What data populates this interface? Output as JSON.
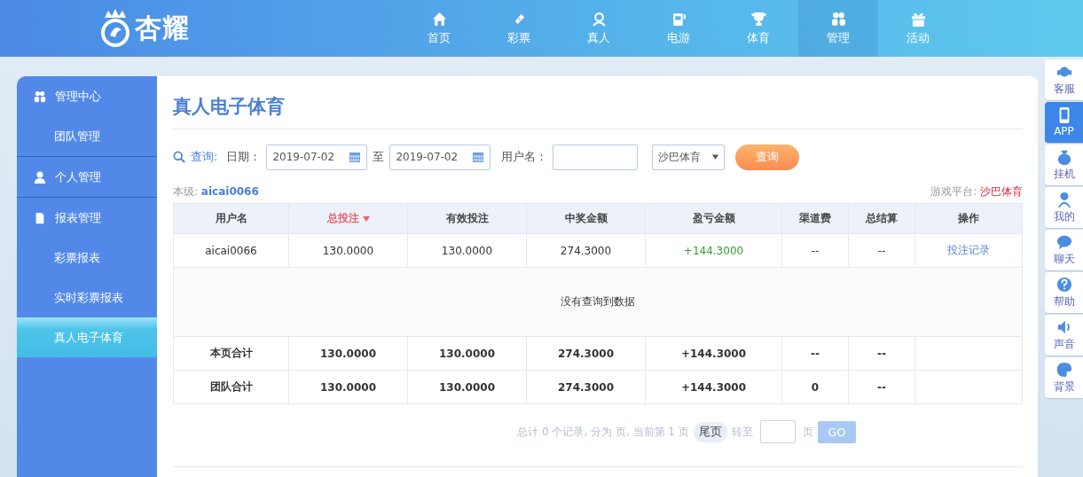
{
  "header": {
    "logo": "杏耀",
    "nav": [
      {
        "label": "首页",
        "selected": false
      },
      {
        "label": "彩票",
        "selected": false
      },
      {
        "label": "真人",
        "selected": false
      },
      {
        "label": "电游",
        "selected": false
      },
      {
        "label": "体育",
        "selected": false
      },
      {
        "label": "管理",
        "selected": true
      },
      {
        "label": "活动",
        "selected": false
      }
    ]
  },
  "sidebar": [
    {
      "label": "管理中心",
      "children": [
        {
          "label": "团队管理",
          "selected": false
        }
      ]
    },
    {
      "label": "个人管理"
    },
    {
      "label": "报表管理",
      "children": [
        {
          "label": "彩票报表",
          "selected": false
        },
        {
          "label": "实时彩票报表",
          "selected": false
        },
        {
          "label": "真人电子体育",
          "selected": true
        }
      ]
    }
  ],
  "page_title": "真人电子体育",
  "filter": {
    "query_label": "查询:",
    "date_label": "日期：",
    "date_from": "2019-07-02",
    "to_label": "至",
    "date_to": "2019-07-02",
    "user_label": "用户名：",
    "platform": "沙巴体育",
    "submit": "查询"
  },
  "info": {
    "level_label": "本级:",
    "level_user": "aicai0066",
    "platform_label": "游戏平台:",
    "platform_value": "沙巴体育"
  },
  "table": {
    "columns": [
      {
        "label": "用户名",
        "sorted": false
      },
      {
        "label": "总投注",
        "sorted": true
      },
      {
        "label": "有效投注",
        "sorted": false
      },
      {
        "label": "中奖金额",
        "sorted": false
      },
      {
        "label": "盈亏金额",
        "sorted": false
      },
      {
        "label": "渠道费",
        "sorted": false
      },
      {
        "label": "总结算",
        "sorted": false
      },
      {
        "label": "操作",
        "sorted": false
      }
    ],
    "rows": [
      {
        "cells": [
          "aicai0066",
          "130.0000",
          "130.0000",
          "274.3000",
          "+144.3000",
          "--",
          "--"
        ],
        "action": "投注记录"
      }
    ],
    "empty_message": "没有查询到数据",
    "totals": [
      {
        "cells": [
          "本页合计",
          "130.0000",
          "130.0000",
          "274.3000",
          "+144.3000",
          "--",
          "--"
        ]
      },
      {
        "cells": [
          "团队合计",
          "130.0000",
          "130.0000",
          "274.3000",
          "+144.3000",
          "0",
          "--"
        ]
      }
    ]
  },
  "pagination": {
    "summary": "总计 0 个记录, 分为 页, 当前第 1 页",
    "last": "尾页",
    "goto": "转至",
    "page_unit": "页",
    "go": "GO"
  },
  "side_tools": [
    {
      "label": "客服",
      "selected": false
    },
    {
      "label": "APP",
      "selected": true
    },
    {
      "label": "挂机",
      "selected": false
    },
    {
      "label": "我的",
      "selected": false
    },
    {
      "label": "聊天",
      "selected": false
    },
    {
      "label": "帮助",
      "selected": false
    },
    {
      "label": "声音",
      "selected": false
    },
    {
      "label": "背景",
      "selected": false
    }
  ]
}
